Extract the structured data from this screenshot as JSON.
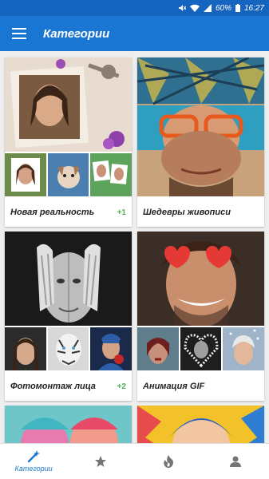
{
  "status": {
    "battery": "60%",
    "time": "16:27"
  },
  "app_bar": {
    "title": "Категории"
  },
  "cards": [
    {
      "label": "Новая реальность",
      "badge": "+1"
    },
    {
      "label": "Шедевры живописи",
      "badge": ""
    },
    {
      "label": "Фотомонтаж лица",
      "badge": "+2"
    },
    {
      "label": "Анимация GIF",
      "badge": ""
    }
  ],
  "bottom_nav": {
    "active_label": "Категории",
    "items": [
      "magic-wand-icon",
      "star-icon",
      "flame-icon",
      "person-icon"
    ],
    "accent": "#1976d2",
    "inactive": "#757575"
  },
  "colors": {
    "status_bar": "#1565c0",
    "app_bar": "#1976d2",
    "badge": "#4caf50"
  }
}
